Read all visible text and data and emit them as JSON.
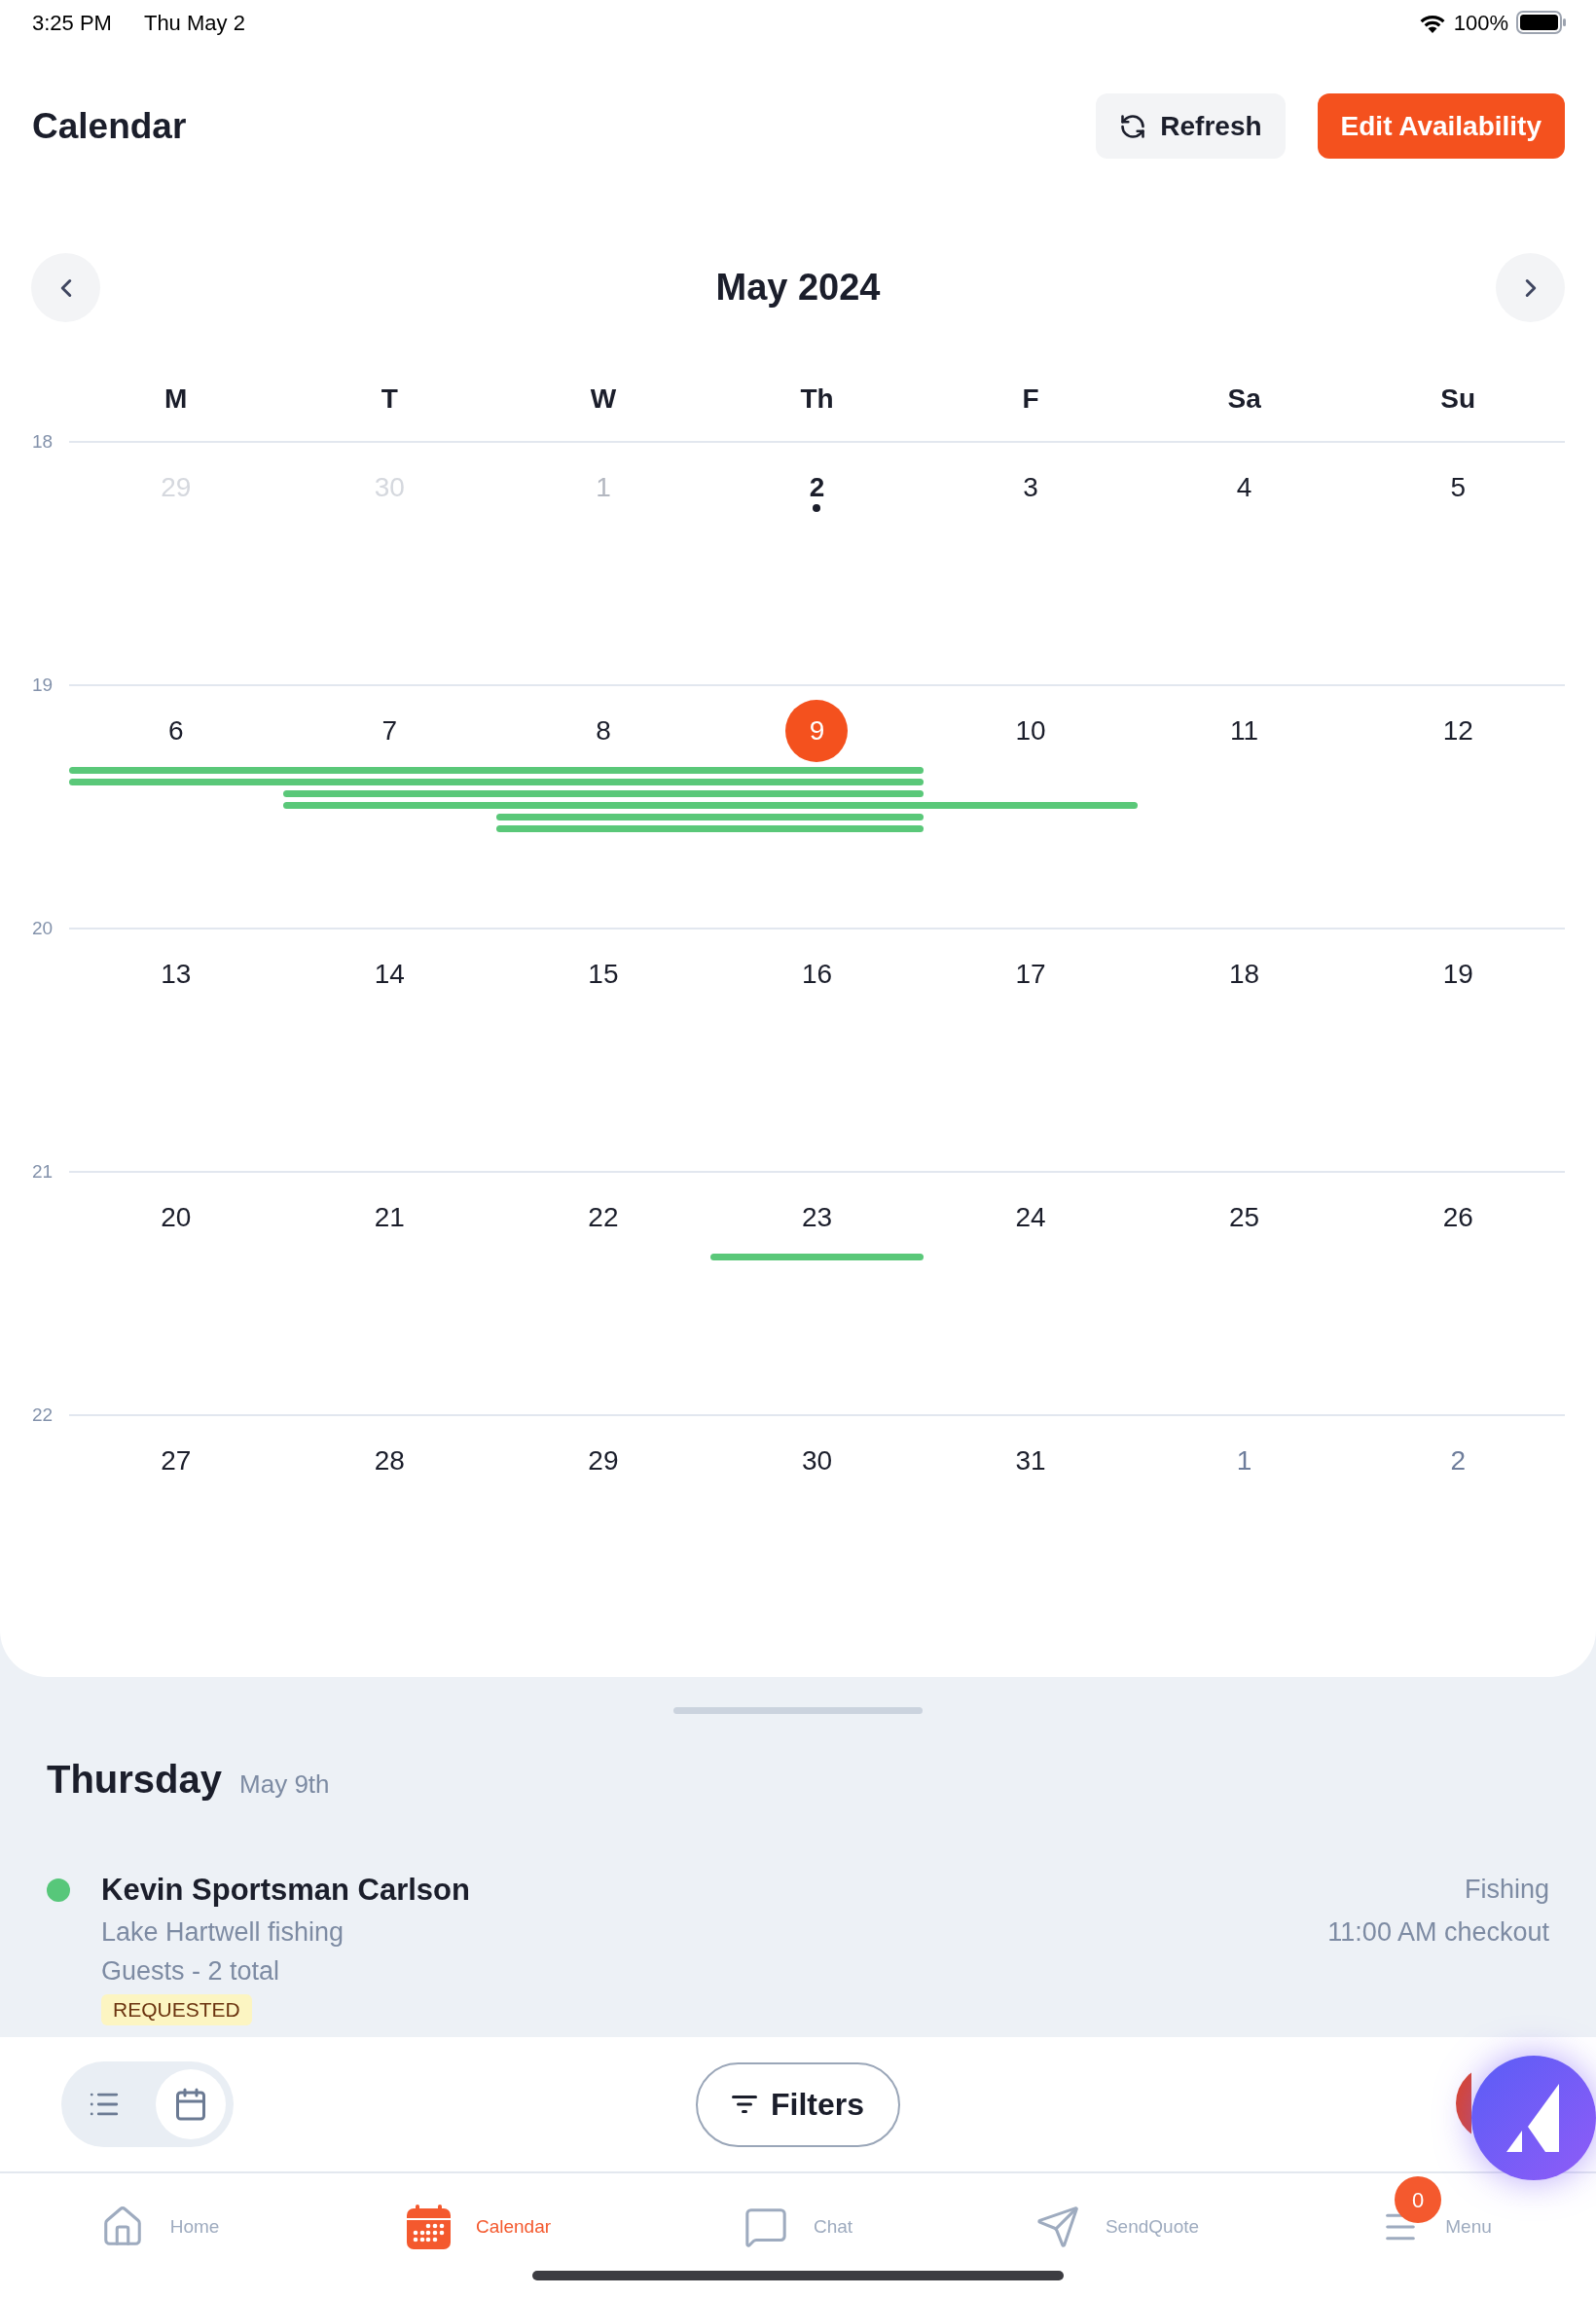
{
  "status_bar": {
    "time": "3:25 PM",
    "date": "Thu May 2",
    "battery": "100%"
  },
  "header": {
    "title": "Calendar",
    "buttons": [
      {
        "label": "Refresh",
        "kind": "refresh"
      },
      {
        "label": "Edit Availability",
        "kind": "primary"
      }
    ]
  },
  "calendar": {
    "month": "May 2024",
    "weekdays": [
      "M",
      "T",
      "W",
      "Th",
      "F",
      "Sa",
      "Su"
    ],
    "weeks": [
      {
        "week_number": "18",
        "days": [
          {
            "day": "29",
            "kind": "prev_month",
            "selected": false
          },
          {
            "day": "30",
            "kind": "prev_month",
            "selected": false
          },
          {
            "day": "1",
            "kind": "past",
            "selected": false
          },
          {
            "day": "2",
            "kind": "today",
            "selected": false
          },
          {
            "day": "3",
            "kind": "current",
            "selected": false
          },
          {
            "day": "4",
            "kind": "current",
            "selected": false
          },
          {
            "day": "5",
            "kind": "current",
            "selected": false
          }
        ]
      },
      {
        "week_number": "19",
        "days": [
          {
            "day": "6",
            "kind": "current",
            "selected": false
          },
          {
            "day": "7",
            "kind": "current",
            "selected": false
          },
          {
            "day": "8",
            "kind": "current",
            "selected": false
          },
          {
            "day": "9",
            "kind": "current",
            "selected": true
          },
          {
            "day": "10",
            "kind": "current",
            "selected": false
          },
          {
            "day": "11",
            "kind": "current",
            "selected": false
          },
          {
            "day": "12",
            "kind": "current",
            "selected": false
          }
        ],
        "event_bars": [
          {
            "kind": "mon_thu"
          },
          {
            "kind": "mon_thu"
          },
          {
            "kind": "tue_thu"
          },
          {
            "kind": "tue_fri"
          },
          {
            "kind": "wed_thu"
          },
          {
            "kind": "wed_thu"
          }
        ]
      },
      {
        "week_number": "20",
        "days": [
          {
            "day": "13",
            "kind": "current",
            "selected": false
          },
          {
            "day": "14",
            "kind": "current",
            "selected": false
          },
          {
            "day": "15",
            "kind": "current",
            "selected": false
          },
          {
            "day": "16",
            "kind": "current",
            "selected": false
          },
          {
            "day": "17",
            "kind": "current",
            "selected": false
          },
          {
            "day": "18",
            "kind": "current",
            "selected": false
          },
          {
            "day": "19",
            "kind": "current",
            "selected": false
          }
        ]
      },
      {
        "week_number": "21",
        "days": [
          {
            "day": "20",
            "kind": "current",
            "selected": false
          },
          {
            "day": "21",
            "kind": "current",
            "selected": false
          },
          {
            "day": "22",
            "kind": "current",
            "selected": false
          },
          {
            "day": "23",
            "kind": "current",
            "selected": false
          },
          {
            "day": "24",
            "kind": "current",
            "selected": false
          },
          {
            "day": "25",
            "kind": "current",
            "selected": false
          },
          {
            "day": "26",
            "kind": "current",
            "selected": false
          }
        ],
        "event_bars": [
          {
            "kind": "thu_thu"
          }
        ]
      },
      {
        "week_number": "22",
        "days": [
          {
            "day": "27",
            "kind": "current",
            "selected": false
          },
          {
            "day": "28",
            "kind": "current",
            "selected": false
          },
          {
            "day": "29",
            "kind": "current",
            "selected": false
          },
          {
            "day": "30",
            "kind": "current",
            "selected": false
          },
          {
            "day": "31",
            "kind": "current",
            "selected": false
          },
          {
            "day": "1",
            "kind": "next_month",
            "selected": false
          },
          {
            "day": "2",
            "kind": "next_month",
            "selected": false
          }
        ]
      }
    ]
  },
  "day_detail": {
    "weekday": "Thursday",
    "date": "May 9th",
    "events": [
      {
        "name": "Kevin Sportsman Carlson",
        "subtitle": "Lake Hartwell fishing",
        "guests": "Guests - 2 total",
        "status": "REQUESTED",
        "category": "Fishing",
        "time": "11:00 AM checkout",
        "color": "#57c77a"
      }
    ]
  },
  "toolbar": {
    "views": [
      {
        "kind": "list",
        "selected": false
      },
      {
        "kind": "calendar",
        "selected": true
      }
    ],
    "filters": "Filters"
  },
  "tab_bar": {
    "items": [
      {
        "label": "Home",
        "kind": "home",
        "selected": false
      },
      {
        "label": "Calendar",
        "kind": "calendar",
        "selected": true
      },
      {
        "label": "Chat",
        "kind": "chat",
        "selected": false
      },
      {
        "label": "SendQuote",
        "kind": "send",
        "selected": false
      },
      {
        "label": "Menu",
        "kind": "menu",
        "selected": false,
        "badge": "0"
      }
    ]
  }
}
